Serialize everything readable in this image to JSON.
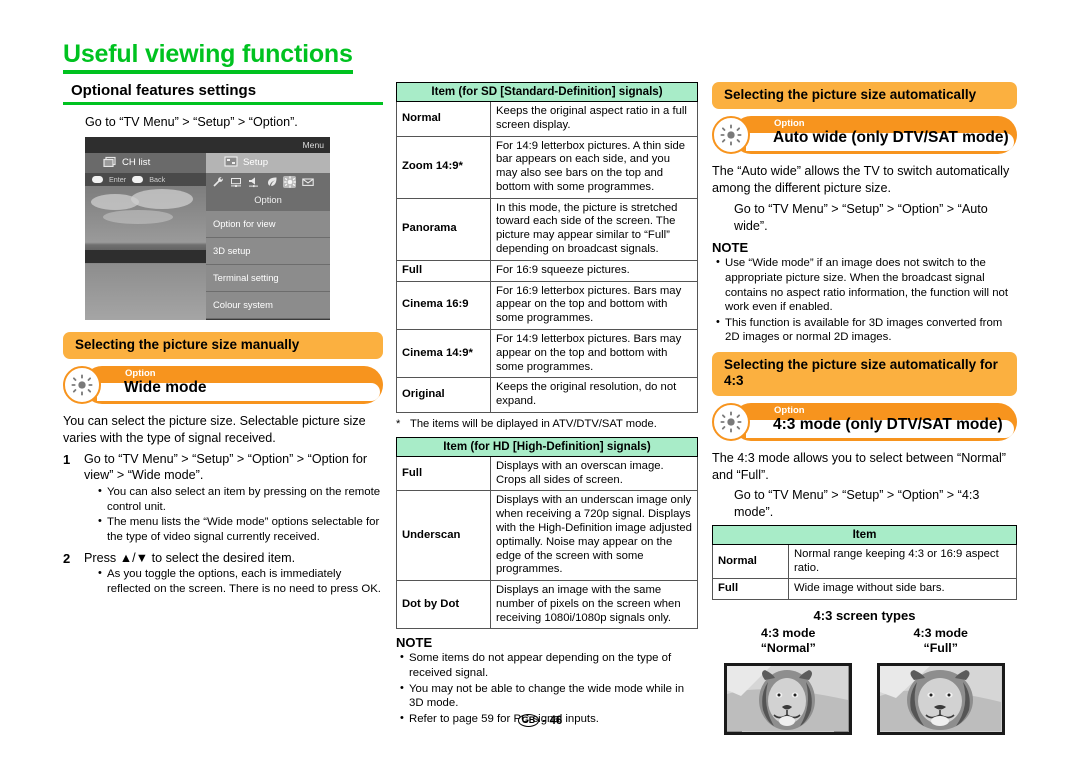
{
  "page": {
    "title": "Useful viewing functions",
    "footer_mark": "GB",
    "footer_page": "- 46"
  },
  "left": {
    "section_heading": "Optional features settings",
    "intro": "Go to “TV Menu” > “Setup” > “Option”.",
    "tv_menu": {
      "menu_label": "Menu",
      "tab_chlist": "CH list",
      "tab_setup": "Setup",
      "hint_enter": "Enter",
      "hint_back": "Back",
      "icon_caption": "Option",
      "icons": [
        "wrench-icon",
        "monitor-icon",
        "speaker-icon",
        "leaf-icon",
        "gear-icon",
        "envelope-icon"
      ],
      "items": [
        "Option for view",
        "3D setup",
        "Terminal setting",
        "Colour system"
      ]
    },
    "band_manual": "Selecting the picture size manually",
    "option_badge": "Option",
    "option_title": "Wide mode",
    "body1": "You can select the picture size. Selectable picture size varies with the type of signal received.",
    "step1_num": "1",
    "step1_text": "Go to “TV Menu” > “Setup” > “Option” > “Option for view” > “Wide mode”.",
    "step1_bullets": [
      "You can also select an item by pressing  on the remote control unit.",
      "The menu lists the “Wide mode” options selectable for the type of video signal currently received."
    ],
    "step2_num": "2",
    "step2_text": "Press ▲/▼ to select the desired item.",
    "step2_bullets": [
      "As you toggle the options, each is immediately reflected on the screen. There is no need to press OK."
    ]
  },
  "mid": {
    "sd_table": {
      "header": "Item (for SD [Standard-Definition] signals)",
      "rows": [
        {
          "k": "Normal",
          "v": "Keeps the original aspect ratio in a full screen display."
        },
        {
          "k": "Zoom 14:9*",
          "v": "For 14:9 letterbox pictures. A thin side bar appears on each side, and you may also see bars on the top and bottom with some programmes."
        },
        {
          "k": "Panorama",
          "v": "In this mode, the picture is stretched toward each side of the screen. The picture may appear similar to “Full” depending on broadcast signals."
        },
        {
          "k": "Full",
          "v": "For 16:9 squeeze pictures."
        },
        {
          "k": "Cinema 16:9",
          "v": "For 16:9 letterbox pictures. Bars may appear on the top and bottom with some programmes."
        },
        {
          "k": "Cinema 14:9*",
          "v": "For 14:9 letterbox pictures. Bars may appear on the top and bottom with some programmes."
        },
        {
          "k": "Original",
          "v": "Keeps the original resolution, do not expand."
        }
      ],
      "footnote_mark": "*",
      "footnote": "The items will be diplayed in ATV/DTV/SAT mode."
    },
    "hd_table": {
      "header": "Item (for HD [High-Definition] signals)",
      "rows": [
        {
          "k": "Full",
          "v": "Displays with an overscan image. Crops all sides of screen."
        },
        {
          "k": "Underscan",
          "v": "Displays with an underscan image only when receiving a 720p signal. Displays with the High-Definition image adjusted optimally. Noise may appear on the edge of the screen with some programmes."
        },
        {
          "k": "Dot by Dot",
          "v": "Displays an image with the same number of pixels on the screen when receiving 1080i/1080p signals only."
        }
      ]
    },
    "note_head": "NOTE",
    "notes": [
      "Some items do not appear depending on the type of received signal.",
      "You may not be able to change the wide mode while in 3D mode.",
      "Refer to page 59 for PC signal inputs."
    ]
  },
  "right": {
    "band_auto": "Selecting the picture size automatically",
    "option_badge": "Option",
    "option_title_auto": "Auto wide (only DTV/SAT mode)",
    "auto_body": "The “Auto wide” allows the TV to switch automatically among the different picture size.",
    "auto_goto": "Go to “TV Menu” > “Setup” > “Option” > “Auto wide”.",
    "note_head": "NOTE",
    "auto_notes": [
      "Use “Wide mode” if an image does not switch to the appropriate picture size. When the broadcast signal contains no aspect ratio information, the function will not work even if enabled.",
      "This function is available for 3D images converted from 2D images or normal 2D images."
    ],
    "band_43": "Selecting the picture size automatically for 4:3",
    "option_title_43": "4:3 mode (only DTV/SAT mode)",
    "body_43": "The 4:3 mode allows you to select between “Normal” and “Full”.",
    "goto_43": "Go to “TV Menu” > “Setup” > “Option” > “4:3 mode”.",
    "table_43": {
      "header": "Item",
      "rows": [
        {
          "k": "Normal",
          "v": "Normal range keeping 4:3 or 16:9 aspect ratio."
        },
        {
          "k": "Full",
          "v": "Wide image without side bars."
        }
      ]
    },
    "screen_types_title": "4:3 screen types",
    "screens": [
      {
        "line1": "4:3 mode",
        "line2": "“Normal”"
      },
      {
        "line1": "4:3 mode",
        "line2": "“Full”"
      }
    ]
  },
  "colors": {
    "brand_green": "#00c220",
    "table_header_green": "#a8ecc8",
    "band_orange": "#fbb040",
    "pill_orange": "#f7941e"
  }
}
